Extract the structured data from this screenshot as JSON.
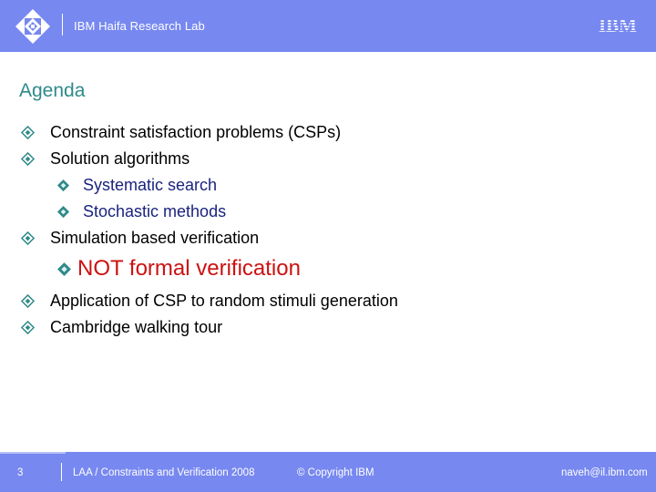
{
  "header": {
    "lab_name": "IBM Haifa Research Lab",
    "logo_icon": "ibm-research-diamond-logo",
    "brand_logo": "IBM",
    "background_color": "#7788f0"
  },
  "slide": {
    "title": "Agenda",
    "title_color": "#2f8a8a",
    "bullet_icon": "diamond-bullet-icon",
    "bullet_color": "#2f8a8a",
    "items": [
      {
        "text": "Constraint satisfaction problems (CSPs)",
        "level": 1
      },
      {
        "text": "Solution algorithms",
        "level": 1
      },
      {
        "text": "Systematic search",
        "level": 2
      },
      {
        "text": "Stochastic methods",
        "level": 2
      },
      {
        "text": "Simulation based verification",
        "level": 1
      },
      {
        "text": "NOT formal verification",
        "level": 2,
        "emphasis": true
      },
      {
        "text": "Application of CSP to random stimuli generation",
        "level": 1
      },
      {
        "text": "Cambridge walking tour",
        "level": 1
      }
    ],
    "sub_item_color": "#1a237e",
    "emphasis_color": "#cc1111"
  },
  "footer": {
    "page_number": "3",
    "course": "LAA / Constraints and Verification 2008",
    "copyright": "© Copyright IBM",
    "email": "naveh@il.ibm.com"
  }
}
